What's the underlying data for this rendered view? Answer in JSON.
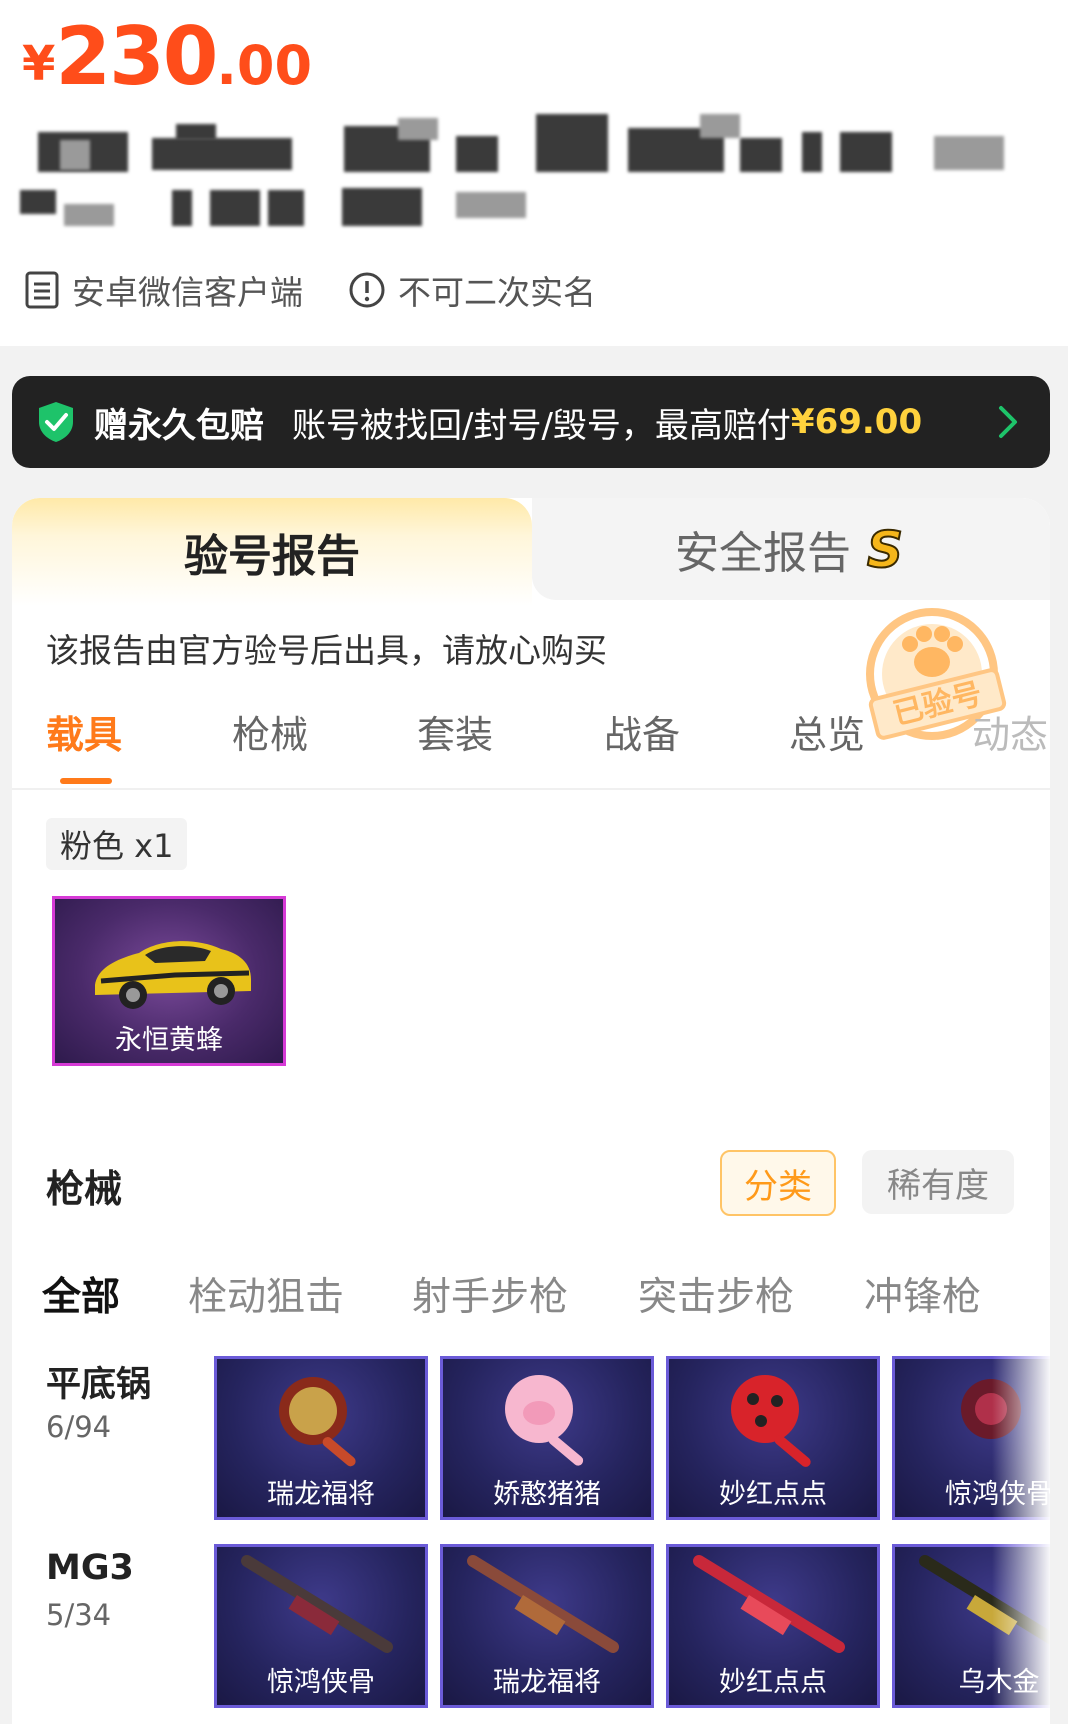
{
  "price": {
    "currency": "¥",
    "integer": "230",
    "decimal": ".00"
  },
  "meta": {
    "client": "安卓微信客户端",
    "realname": "不可二次实名"
  },
  "banner": {
    "title": "赠永久包赔",
    "text": "账号被找回/封号/毁号，最高赔付",
    "amount": "¥69.00"
  },
  "report": {
    "tab_check": "验号报告",
    "tab_security": "安全报告",
    "security_badge": "S",
    "desc": "该报告由官方验号后出具，请放心购买",
    "stamp": "已验号",
    "categories": [
      "载具",
      "枪械",
      "套装",
      "战备",
      "总览",
      "动态"
    ]
  },
  "vehicles": {
    "tag": "粉色 x1",
    "items": [
      {
        "name": "永恒黄蜂"
      }
    ]
  },
  "weapons": {
    "title": "枪械",
    "btn_category": "分类",
    "btn_rarity": "稀有度",
    "tabs": [
      "全部",
      "栓动狙击",
      "射手步枪",
      "突击步枪",
      "冲锋枪"
    ],
    "rows": [
      {
        "name": "平底锅",
        "count": "6/94",
        "items": [
          "瑞龙福将",
          "娇憨猪猪",
          "妙红点点",
          "惊鸿侠骨"
        ]
      },
      {
        "name": "MG3",
        "count": "5/34",
        "items": [
          "惊鸿侠骨",
          "瑞龙福将",
          "妙红点点",
          "乌木金"
        ]
      }
    ]
  },
  "colors": {
    "price": "#ff4d1a",
    "accent": "#ff7a1a",
    "gold": "#ffd23d",
    "vehicle_border": "#d63ad6",
    "weapon_border": "#6b5bd8"
  }
}
